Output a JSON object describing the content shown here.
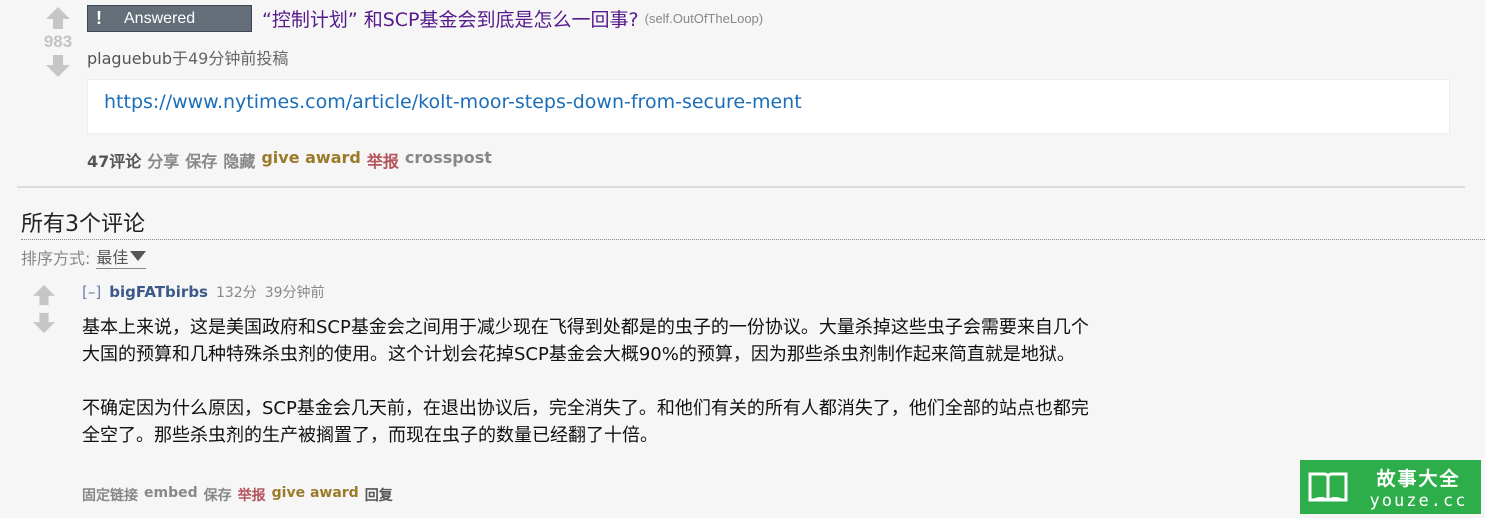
{
  "post": {
    "score": "983",
    "flair": "Answered",
    "flair_icon": "!",
    "title": "“控制计划” 和SCP基金会到底是怎么一回事?",
    "domain": "(self.OutOfTheLoop)",
    "author": "plaguebub",
    "tagline_suffix": "于49分钟前投稿",
    "link": "https://www.nytimes.com/article/kolt-moor-steps-down-from-secure-ment",
    "buttons": {
      "comments": "47评论",
      "share": "分享",
      "save": "保存",
      "hide": "隐藏",
      "give_award": "give award",
      "report": "举报",
      "crosspost": "crosspost"
    }
  },
  "comments_section": {
    "title": "所有3个评论",
    "sort_label": "排序方式:",
    "sort_value": "最佳"
  },
  "comment": {
    "collapse": "[–]",
    "author": "bigFATbirbs",
    "points": "132分",
    "time": "39分钟前",
    "paragraph1": "基本上来说，这是美国政府和SCP基金会之间用于减少现在飞得到处都是的虫子的一份协议。大量杀掉这些虫子会需要来自几个大国的预算和几种特殊杀虫剂的使用。这个计划会花掉SCP基金会大概90%的预算，因为那些杀虫剂制作起来简直就是地狱。",
    "paragraph2": "不确定因为什么原因，SCP基金会几天前，在退出协议后，完全消失了。和他们有关的所有人都消失了，他们全部的站点也都完全空了。那些杀虫剂的生产被搁置了，而现在虫子的数量已经翻了十倍。",
    "buttons": {
      "permalink": "固定链接",
      "embed": "embed",
      "save": "保存",
      "report": "举报",
      "give_award": "give award",
      "reply": "回复"
    }
  },
  "watermark": {
    "cn": "故事大全",
    "en": "youze.cc",
    "icon": "book-icon"
  },
  "colors": {
    "background": "#f6f6f6",
    "title_visited": "#551a8b",
    "link": "#1a6eb8",
    "flair_bg": "#646e78",
    "award": "#9a7b2a",
    "report": "#b5545d",
    "watermark_bg": "#2eae4b"
  }
}
